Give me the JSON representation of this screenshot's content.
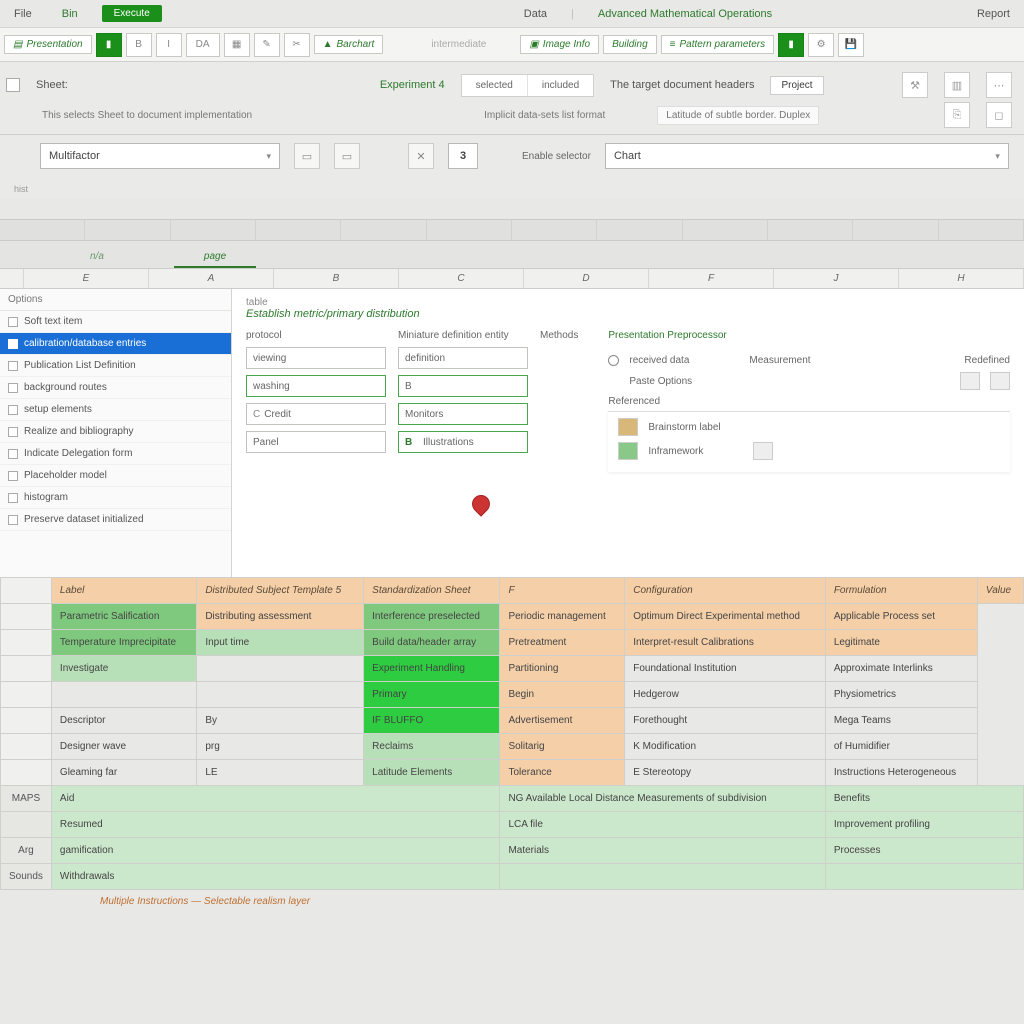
{
  "menu": {
    "m1": "File",
    "m2": "Bin",
    "btn_green": "Execute",
    "m_right1": "Data",
    "m_right2": "Advanced Mathematical Operations",
    "m_far": "Report"
  },
  "ribbon": {
    "b1": "Presentation",
    "b2": "B",
    "b3": "I",
    "b4": "DA",
    "b5": "Barchart",
    "c1": "Image Info",
    "c2": "Building",
    "c3": "Pattern parameters"
  },
  "panel": {
    "lbl1": "Sheet:",
    "desc1": "This selects Sheet to document implementation",
    "link1": "Experiment 4",
    "tab1": "selected",
    "tab2": "included",
    "lbl2": "The target document headers",
    "val2": "Project",
    "desc2": "Implicit data-sets list format",
    "desc3": "Latitude of subtle border. Duplex",
    "filter_sel": "Multifactor",
    "num": "3",
    "lbl3": "Enable selector",
    "filter_val": "Chart",
    "mini_lbl": "hist"
  },
  "sheet_tabs": {
    "t1": "n/a",
    "t2": "page"
  },
  "grid_cols": [
    "",
    "E",
    "A",
    "B",
    "C",
    "D",
    "F",
    "J",
    "H"
  ],
  "sidebar": {
    "head": "Options",
    "items": [
      "Soft text item",
      "calibration/database entries",
      "Publication List Definition",
      "background routes",
      "setup elements",
      "Realize and bibliography",
      "Indicate Delegation form",
      "Placeholder model",
      "histogram",
      "Preserve dataset initialized"
    ],
    "selected_index": 1
  },
  "config": {
    "small": "table",
    "heading": "Establish metric/primary distribution",
    "col_a": "protocol",
    "col_b": "Miniature definition entity",
    "col_c": "Methods",
    "r1a": "viewing",
    "r1b": "definition",
    "r2a": "washing",
    "r2b": "B",
    "r3a": "Credit",
    "r3b": "Monitors",
    "r4a": "Panel",
    "r4b": "B",
    "r4c": "Illustrations",
    "right_head": "Presentation Preprocessor",
    "right_r1": "received data",
    "right_r1b": "Measurement",
    "right_r2": "Paste Options",
    "right_r2b": "Redefined",
    "right_sec": "Referenced",
    "right_i1": "Brainstorm label",
    "right_i2": "Inframework"
  },
  "table": {
    "headers": [
      "Label",
      "Distributed Subject Template 5",
      "Standardization Sheet",
      "F",
      "Configuration",
      "Formulation",
      "Value"
    ],
    "rows": [
      {
        "cells": [
          "",
          "Parametric Salification",
          "Distributing assessment",
          "Interference preselected",
          "Periodic management",
          "Optimum Direct Experimental method",
          "Applicable Process set"
        ],
        "cls": [
          "rownum",
          "bg-green-med",
          "bg-peach",
          "bg-green-med",
          "bg-peach",
          "bg-peach",
          "bg-peach"
        ]
      },
      {
        "cells": [
          "",
          "Temperature Imprecipitate",
          "Input time",
          "Build data/header array",
          "Pretreatment",
          "Interpret-result Calibrations",
          "Legitimate"
        ],
        "cls": [
          "rownum",
          "bg-green-med",
          "bg-green-light",
          "bg-green-med",
          "bg-peach",
          "bg-peach",
          "bg-peach"
        ]
      },
      {
        "cells": [
          "",
          "Investigate",
          "",
          "Experiment Handling",
          "Partitioning",
          "Foundational Institution",
          "Approximate Interlinks"
        ],
        "cls": [
          "rownum",
          "bg-green-light",
          "",
          "bg-green-bright",
          "bg-peach",
          "",
          ""
        ]
      },
      {
        "cells": [
          "",
          "",
          "",
          "Primary",
          "Begin",
          "Hedgerow",
          "Physiometrics"
        ],
        "cls": [
          "rownum",
          "",
          "",
          "bg-green-bright",
          "bg-peach",
          "",
          ""
        ]
      },
      {
        "cells": [
          "",
          "Descriptor",
          "By",
          "IF BLUFFO",
          "Advertisement",
          "Forethought",
          "Mega Teams"
        ],
        "cls": [
          "rownum",
          "",
          "",
          "bg-green-bright",
          "bg-peach",
          "",
          ""
        ]
      },
      {
        "cells": [
          "",
          "Designer wave",
          "prg",
          "Reclaims",
          "Solitarig",
          "K Modification",
          "of Humidifier"
        ],
        "cls": [
          "rownum",
          "",
          "",
          "bg-green-light",
          "bg-peach",
          "",
          ""
        ]
      },
      {
        "cells": [
          "",
          "Gleaming far",
          "LE",
          "Latitude Elements",
          "Tolerance",
          "E Stereotopy",
          "Instructions Heterogeneous"
        ],
        "cls": [
          "rownum",
          "",
          "",
          "bg-green-light",
          "bg-peach",
          "",
          ""
        ]
      }
    ],
    "sections": [
      {
        "label": "MAPS",
        "a": "Aid",
        "c": "NG Available Local Distance Measurements of subdivision",
        "d": "Benefits"
      },
      {
        "label": "",
        "a": "Resumed",
        "c": "LCA file",
        "d": "Improvement profiling"
      },
      {
        "label": "Arg",
        "a": "gamification",
        "c": "Materials",
        "d": "Processes"
      },
      {
        "label": "Sounds",
        "a": "Withdrawals",
        "c": "",
        "d": ""
      }
    ]
  },
  "footer": "Multiple Instructions — Selectable realism layer"
}
